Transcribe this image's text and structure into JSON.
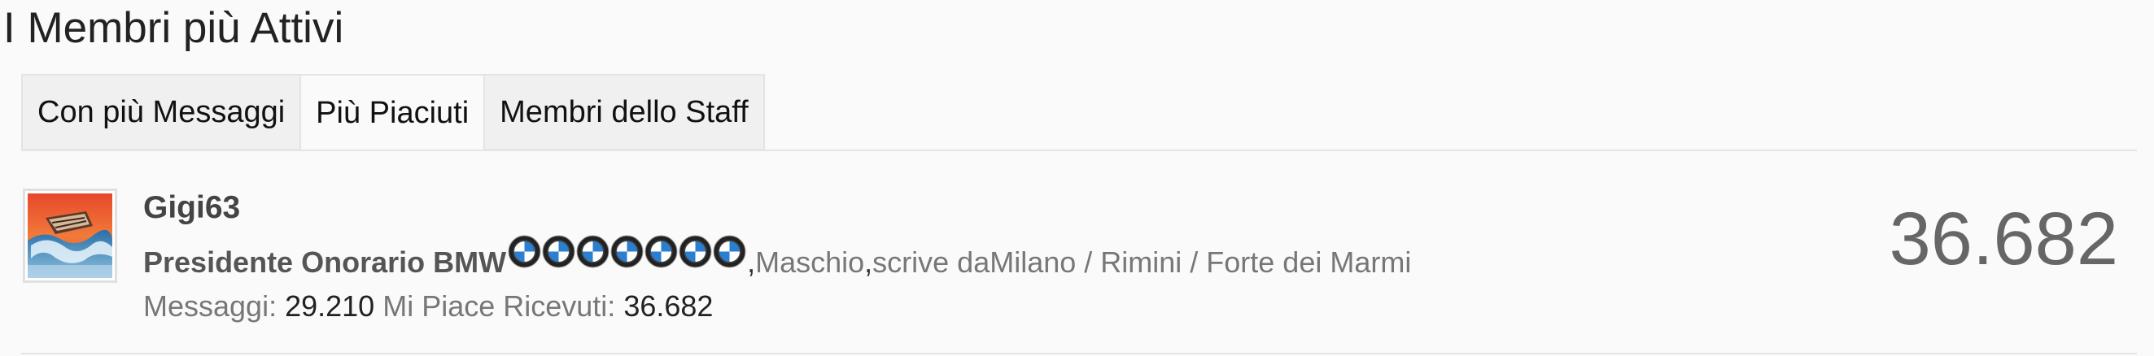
{
  "section": {
    "title": "I Membri più Attivi"
  },
  "tabs": [
    {
      "label": "Con più Messaggi",
      "active": false
    },
    {
      "label": "Più Piaciuti",
      "active": true
    },
    {
      "label": "Membri dello Staff",
      "active": false
    }
  ],
  "member": {
    "username": "Gigi63",
    "user_title": "Presidente Onorario BMW",
    "badge_icons": [
      "bmw-logo-icon",
      "bmw-logo-icon",
      "bmw-logo-icon",
      "bmw-logo-icon",
      "bmw-logo-icon",
      "bmw-logo-icon",
      "bmw-logo-icon"
    ],
    "gender_sep": ", ",
    "gender": "Maschio",
    "sep2": ", ",
    "location_prefix": "scrive da ",
    "location": "Milano / Rimini / Forte dei Marmi",
    "messages_label": "Messaggi:",
    "messages_value": "29.210",
    "likes_label": "Mi Piace Ricevuti:",
    "likes_value": "36.682",
    "big_count": "36.682"
  },
  "colors": {
    "background": "#fafafa",
    "border": "#e4e4e4",
    "tab_inactive": "#f0f0f0",
    "big_count": "#666666"
  }
}
